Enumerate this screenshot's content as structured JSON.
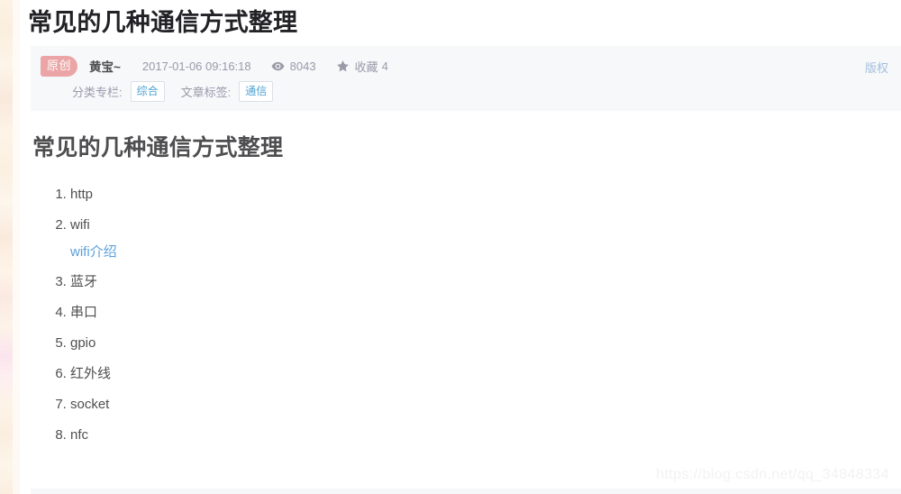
{
  "post": {
    "title": "常见的几种通信方式整理",
    "copyright_label": "版权",
    "meta": {
      "badge": "原创",
      "author": "黄宝~",
      "date": "2017-01-06 09:16:18",
      "views_icon": "eye-icon",
      "views": "8043",
      "favorites_icon": "star-icon",
      "favorites_label": "收藏",
      "favorites_count": "4",
      "category_label": "分类专栏:",
      "category_value": "综合",
      "tag_label": "文章标签:",
      "tag_value": "通信"
    }
  },
  "article": {
    "heading": "常见的几种通信方式整理",
    "list": [
      {
        "text": "http"
      },
      {
        "text": "wifi",
        "link": "wifi介绍"
      },
      {
        "text": "蓝牙"
      },
      {
        "text": "串口"
      },
      {
        "text": "gpio"
      },
      {
        "text": "红外线"
      },
      {
        "text": "socket"
      },
      {
        "text": "nfc"
      }
    ]
  },
  "watermark": "https://blog.csdn.net/qq_34848334",
  "colors": {
    "badge_bg": "#eb9f9f",
    "link": "#5b9fd8",
    "chip_text": "#4ea1d3",
    "meta_bg": "#f7f8fa",
    "copyright": "#a3bede"
  }
}
